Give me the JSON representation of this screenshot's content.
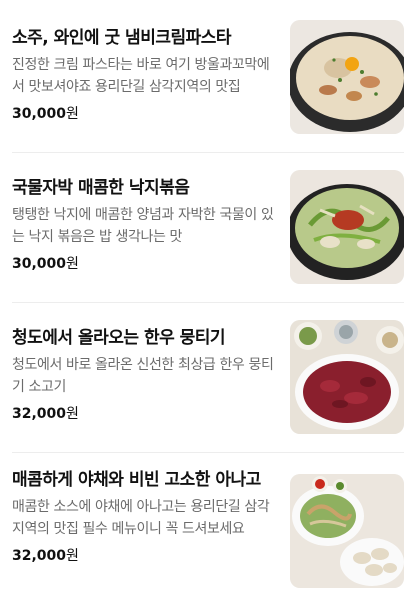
{
  "menu": {
    "currency_suffix": "원",
    "items": [
      {
        "name": "소주, 와인에 굿 냄비크림파스타",
        "description": "진정한 크림 파스타는 바로 여기 방울과꼬막에서 맛보셔야죠 용리단길 삼각지역의 맛집",
        "price": "30,000",
        "image_icon": "cream-pasta-pot-photo"
      },
      {
        "name": "국물자박 매콤한 낙지볶음",
        "description": "탱탱한 낙지에 매콤한 양념과 자박한 국물이 있는 낙지 볶음은 밥 생각나는 맛",
        "price": "30,000",
        "image_icon": "spicy-octopus-pot-photo"
      },
      {
        "name": "청도에서 올라오는 한우 뭉티기",
        "description": "청도에서 바로 올라온 신선한 최상급 한우 뭉티기 소고기",
        "price": "32,000",
        "image_icon": "raw-beef-platter-photo"
      },
      {
        "name": "매콤하게 야채와 비빈 고소한 아나고",
        "description": "매콤한 소스에 야채에 아나고는 용리단길 삼각지역의 맛집 필수 메뉴이니 꼭 드셔보세요",
        "price": "32,000",
        "image_icon": "anago-salad-photo"
      }
    ]
  }
}
